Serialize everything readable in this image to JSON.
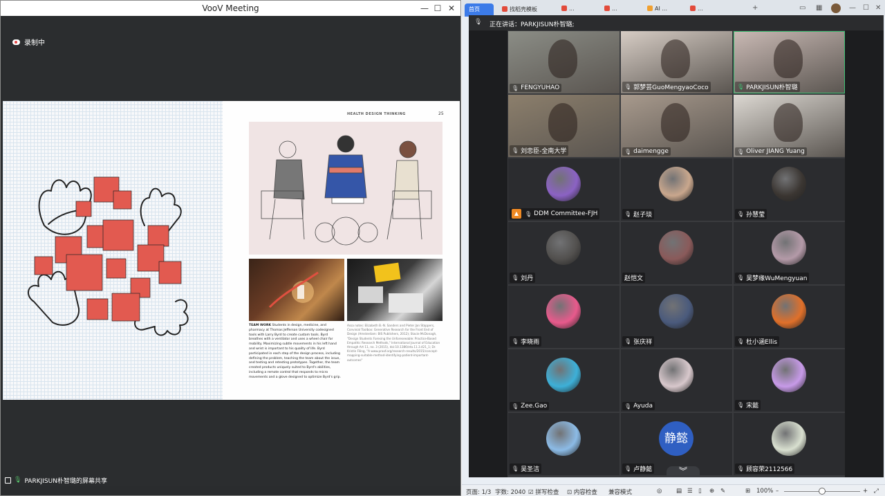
{
  "voov": {
    "title": "VooV Meeting",
    "recording": "录制中",
    "sharing_label": "PARKJISUN朴智璐的屏幕共享",
    "window_controls": {
      "minimize": "—",
      "maximize": "☐",
      "close": "✕"
    }
  },
  "book": {
    "header": "HEALTH DESIGN THINKING",
    "page_number": "25",
    "caption_left_bold": "TEAM WORK",
    "caption_left": "Students in design, medicine, and pharmacy at Thomas Jefferson University codesigned tools with Larry Byrd to create custom tools. Byrd breathes with a ventilator and uses a wheel chair for mobility. Maximizing subtle movements in his left hand and wrist is important to his quality of life. Byrd participated in each step of the design process, including defining the problem, teaching the team about the issue, and testing and retesting prototypes. Together, the team created products uniquely suited to Byrd's abilities, including a remote control that responds to micro movements and a glove designed to optimize Byrd's grip.",
    "caption_right": "Assa notes: Elizabeth B.-N. Sanders and Pieter Jan Stappers, Convivial Toolbox: Generative Research for the Front End of Design (Amsterdam: BIS Publishers, 2012); Stacie McDonagh, \"Design Students Foresing the Unforeseeable: Practice-Based Empathic Research Methods,\" International Journal of Education through Art 11, no. 3 (2015), doi:10.1386/eta.11.3.421_1; Dr. Kristin Filing, \"A www.proof.org/research-results/2015/concept-mapping-suitable-method-identifying-patient-important-outcomes\""
  },
  "browser": {
    "tabs": [
      {
        "label": "首页",
        "active": true
      },
      {
        "label": "找稻壳模板",
        "active": false
      },
      {
        "label": "...",
        "active": false
      },
      {
        "label": "...",
        "active": false
      },
      {
        "label": "AI ...",
        "active": false
      },
      {
        "label": "...",
        "active": false
      }
    ],
    "new_tab": "+"
  },
  "meeting": {
    "speaking_now": "正在讲话：PARKJISUN朴智璐;",
    "participants": [
      {
        "name": "FENGYUHAO",
        "type": "video",
        "video_color": "#8b8d86"
      },
      {
        "name": "郭梦芸GuoMengyaoCoco",
        "type": "video",
        "video_color": "#d6ccc4"
      },
      {
        "name": "PARKJISUN朴智璐",
        "type": "video",
        "video_color": "#c9b9b4",
        "speaking": true
      },
      {
        "name": "刘忠臣-全南大学",
        "type": "video",
        "video_color": "#8c7f6c"
      },
      {
        "name": "daimengge",
        "type": "video",
        "video_color": "#a89a8d"
      },
      {
        "name": "Oliver JIANG Yuang",
        "type": "video",
        "video_color": "#dcd8d2"
      },
      {
        "name": "DDM Committee-FJH",
        "type": "avatar",
        "avatar_color": "#8b62c4",
        "badge": true
      },
      {
        "name": "赵子琰",
        "type": "avatar",
        "avatar_color": "#c9a78d"
      },
      {
        "name": "孙慧莹",
        "type": "avatar",
        "avatar_color": "#3b3632"
      },
      {
        "name": "刘丹",
        "type": "avatar",
        "avatar_color": "#52504e"
      },
      {
        "name": "赵恺文",
        "type": "avatar",
        "avatar_color": "#8a5a5a",
        "no_mic": true
      },
      {
        "name": "吴梦缘WuMengyuan",
        "type": "avatar",
        "avatar_color": "#b49aa8"
      },
      {
        "name": "李晓雨",
        "type": "avatar",
        "avatar_color": "#e85a8c"
      },
      {
        "name": "张庆祥",
        "type": "avatar",
        "avatar_color": "#4a5a7c"
      },
      {
        "name": "杜小涵Ellis",
        "type": "avatar",
        "avatar_color": "#e0702a"
      },
      {
        "name": "Zee.Gao",
        "type": "avatar",
        "avatar_color": "#3db0d8"
      },
      {
        "name": "Ayuda",
        "type": "avatar",
        "avatar_color": "#d8c8cc"
      },
      {
        "name": "宋懿",
        "type": "avatar",
        "avatar_color": "#c79ae8"
      },
      {
        "name": "吴圣洁",
        "type": "avatar",
        "avatar_color": "#8cbbe6"
      },
      {
        "name": "卢静懿",
        "type": "text-avatar",
        "avatar_text": "静懿"
      },
      {
        "name": "顾容荣2112566",
        "type": "avatar",
        "avatar_color": "#d9e0d0"
      }
    ],
    "scroll_down": "︾"
  },
  "status": {
    "page": "页面: 1/3",
    "words": "字数: 2040",
    "spell": "拼写检查",
    "content": "内容检查",
    "compat": "兼容模式",
    "zoom": "100%",
    "zoom_level": 0.5
  }
}
